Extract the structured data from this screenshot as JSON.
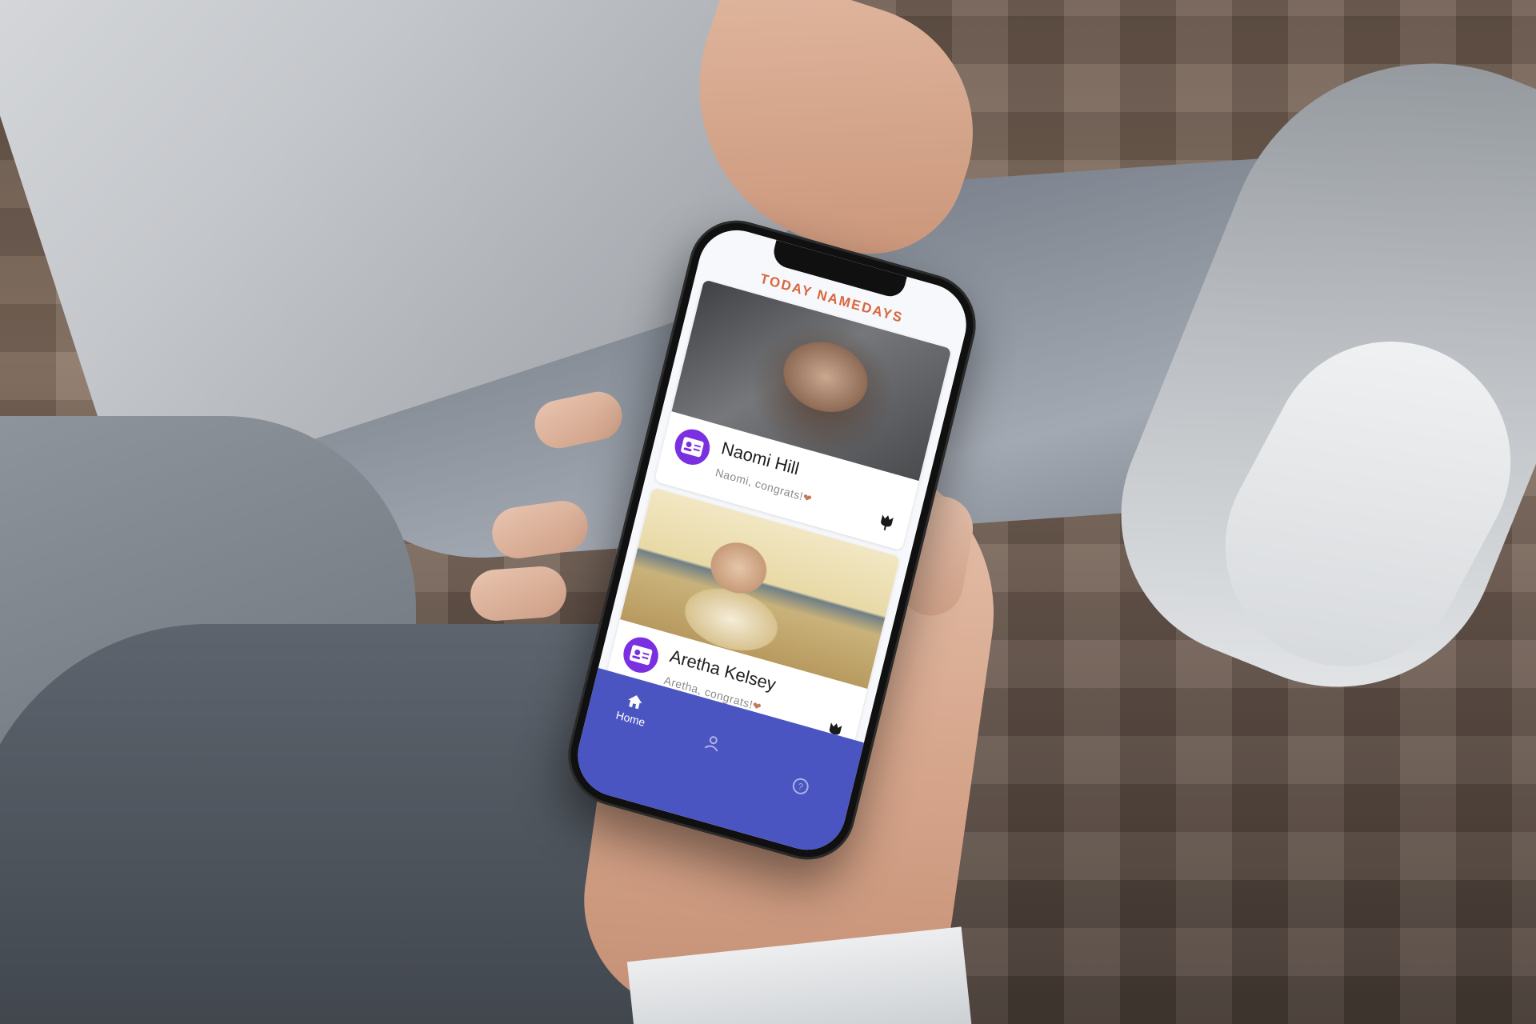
{
  "app": {
    "title": "TODAY NAMEDAYS",
    "accent_color": "#d9663e",
    "tabbar_color": "#4a55c2",
    "avatar_color": "#7a2fe0"
  },
  "cards": [
    {
      "name": "Naomi Hill",
      "message": "Naomi, congrats!",
      "message_icon": "heart-emoji",
      "avatar_icon": "id-card-icon",
      "action_icon": "tulip-icon"
    },
    {
      "name": "Aretha Kelsey",
      "message": "Aretha, congrats!",
      "message_icon": "heart-emoji",
      "avatar_icon": "id-card-icon",
      "action_icon": "tulip-icon"
    }
  ],
  "tabs": [
    {
      "label": "Home",
      "icon": "home-icon",
      "active": true
    },
    {
      "label": "",
      "icon": "profile-icon",
      "active": false
    },
    {
      "label": "",
      "icon": "help-icon",
      "active": false
    }
  ]
}
